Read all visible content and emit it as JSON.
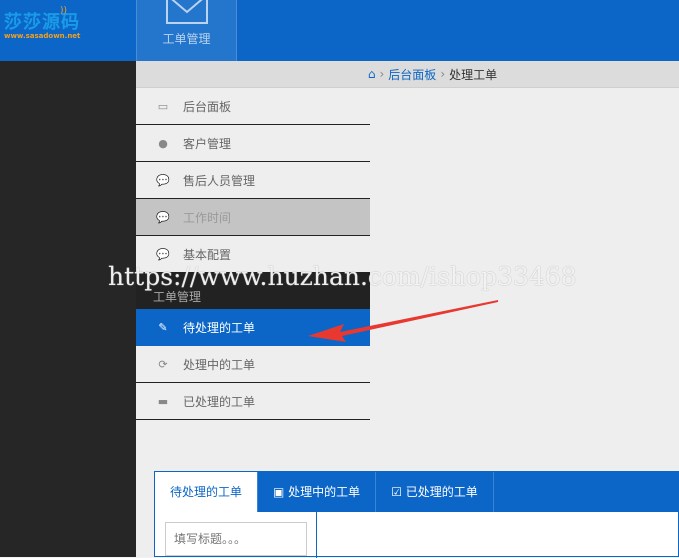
{
  "logo": {
    "name": "莎莎源码",
    "url": "www.sasadown.net"
  },
  "topnav": {
    "label": "工单管理"
  },
  "breadcrumb": {
    "items": [
      "后台面板",
      "处理工单"
    ]
  },
  "menu": {
    "items": [
      {
        "label": "后台面板",
        "icon": "laptop-icon"
      },
      {
        "label": "客户管理",
        "icon": "user-icon"
      },
      {
        "label": "售后人员管理",
        "icon": "comments-icon"
      },
      {
        "label": "工作时间",
        "icon": "comments-icon"
      },
      {
        "label": "基本配置",
        "icon": "comments-icon"
      }
    ],
    "section": "工单管理",
    "sub": [
      {
        "label": "待处理的工单",
        "icon": "pencil-icon"
      },
      {
        "label": "处理中的工单",
        "icon": "refresh-icon"
      },
      {
        "label": "已处理的工单",
        "icon": "briefcase-icon"
      }
    ]
  },
  "watermark": "https://www.huzhan.com/ishop33468",
  "tabs": [
    "待处理的工单",
    "处理中的工单",
    "已处理的工单"
  ],
  "search": {
    "placeholder": "填写标题。。。"
  },
  "colors": {
    "primary": "#0b66c7",
    "dark": "#262626"
  }
}
